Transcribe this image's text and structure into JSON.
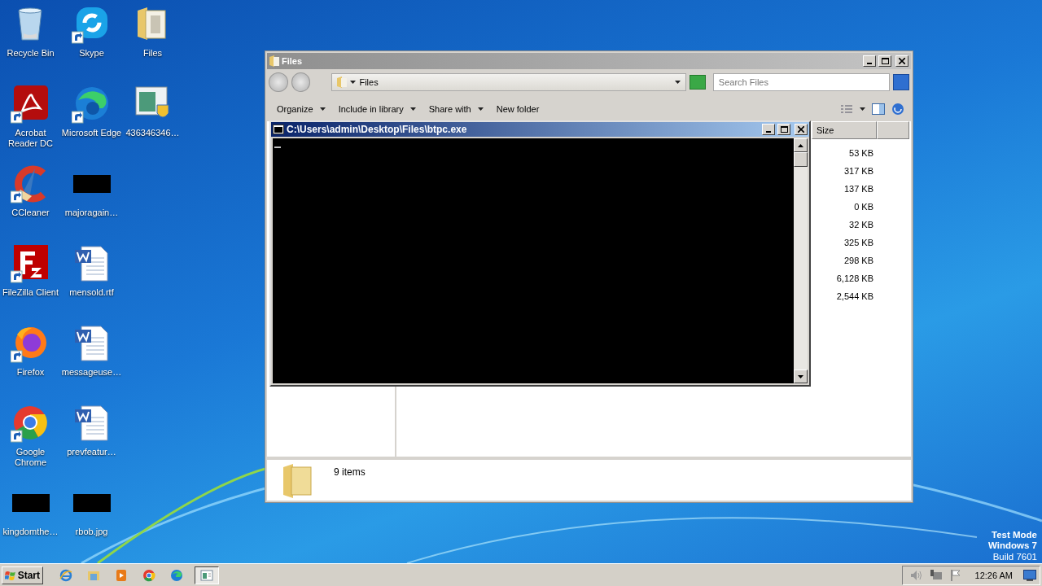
{
  "desktop": {
    "columns": [
      {
        "icons": [
          {
            "label": "Recycle Bin",
            "kind": "recycle",
            "shortcut": false
          },
          {
            "label": "Acrobat Reader DC",
            "kind": "acrobat",
            "shortcut": true
          },
          {
            "label": "CCleaner",
            "kind": "ccleaner",
            "shortcut": true
          },
          {
            "label": "FileZilla Client",
            "kind": "filezilla",
            "shortcut": true
          },
          {
            "label": "Firefox",
            "kind": "firefox",
            "shortcut": true
          },
          {
            "label": "Google Chrome",
            "kind": "chrome",
            "shortcut": true
          },
          {
            "label": "kingdomthe…",
            "kind": "blank",
            "shortcut": false
          }
        ]
      },
      {
        "icons": [
          {
            "label": "Skype",
            "kind": "skype",
            "shortcut": true
          },
          {
            "label": "Microsoft Edge",
            "kind": "edge",
            "shortcut": true
          },
          {
            "label": "majoragain…",
            "kind": "blank",
            "shortcut": false
          },
          {
            "label": "mensold.rtf",
            "kind": "word",
            "shortcut": false
          },
          {
            "label": "messageuse…",
            "kind": "word",
            "shortcut": false
          },
          {
            "label": "prevfeatur…",
            "kind": "word",
            "shortcut": false
          },
          {
            "label": "rbob.jpg",
            "kind": "blank",
            "shortcut": false
          }
        ]
      },
      {
        "icons": [
          {
            "label": "Files",
            "kind": "folder",
            "shortcut": false
          },
          {
            "label": "436346346…",
            "kind": "installer",
            "shortcut": false
          }
        ]
      }
    ]
  },
  "system_text": [
    "Test Mode",
    "Windows 7",
    "Build 7601"
  ],
  "explorer": {
    "title": "Files",
    "address": "Files",
    "search": {
      "placeholder": "Search Files"
    },
    "toolbar": [
      {
        "label": "Organize",
        "dropdown": true
      },
      {
        "label": "Include in library",
        "dropdown": true
      },
      {
        "label": "Share with",
        "dropdown": true
      },
      {
        "label": "New folder",
        "dropdown": false
      }
    ],
    "columns": [
      "Size"
    ],
    "sizes": [
      "53 KB",
      "317 KB",
      "137 KB",
      "0 KB",
      "32 KB",
      "325 KB",
      "298 KB",
      "6,128 KB",
      "2,544 KB"
    ],
    "status": "9 items"
  },
  "console": {
    "title": "C:\\Users\\admin\\Desktop\\Files\\btpc.exe"
  },
  "taskbar": {
    "start": "Start",
    "apps": [
      {
        "kind": "ie",
        "selected": false
      },
      {
        "kind": "explorer",
        "selected": false
      },
      {
        "kind": "media",
        "selected": false
      },
      {
        "kind": "chrome",
        "selected": false
      },
      {
        "kind": "edge",
        "selected": false
      },
      {
        "kind": "console",
        "selected": true
      }
    ],
    "clock": "12:26 AM"
  }
}
